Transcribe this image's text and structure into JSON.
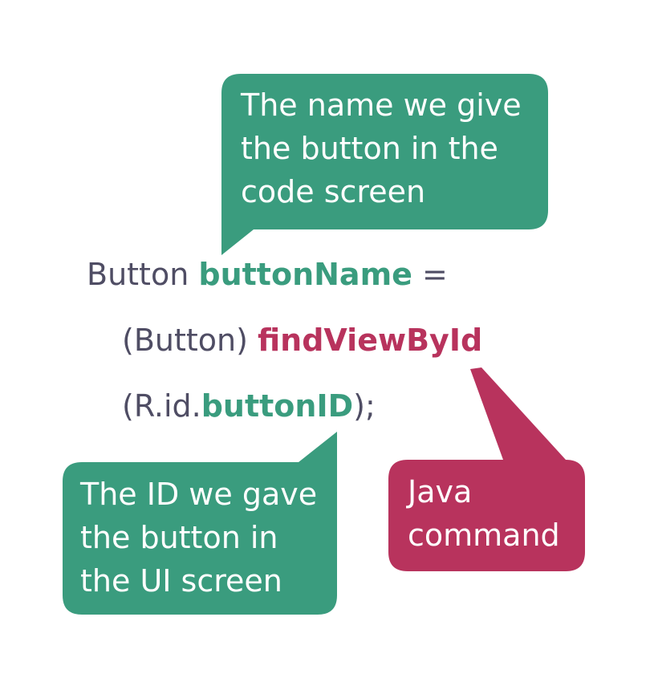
{
  "colors": {
    "green": "#3a9c7e",
    "magenta": "#b8335d",
    "code_text": "#4f4d64",
    "bubble_text": "#ffffff"
  },
  "callouts": {
    "top": {
      "text": "The name we give\nthe button in the\ncode screen"
    },
    "bottom_left": {
      "text": "The ID we gave\nthe button in\nthe UI screen"
    },
    "bottom_right": {
      "text": "Java\ncommand"
    }
  },
  "code": {
    "line1": {
      "plain_before": "Button ",
      "highlight": "buttonName",
      "plain_after": " ="
    },
    "line2": {
      "plain_before": "(Button) ",
      "highlight": "findViewById"
    },
    "line3": {
      "plain_before": "(R.id.",
      "highlight": "buttonID",
      "plain_after": ");"
    }
  }
}
